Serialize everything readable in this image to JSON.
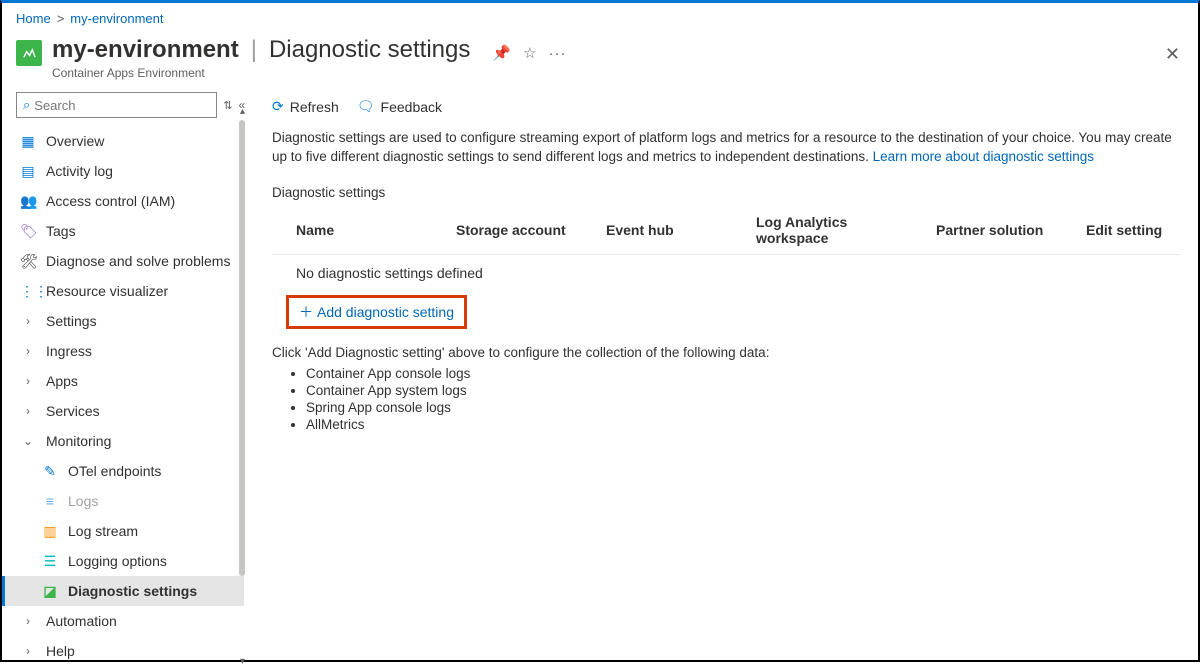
{
  "breadcrumb": {
    "home": "Home",
    "resource": "my-environment"
  },
  "header": {
    "resource_name": "my-environment",
    "page_title": "Diagnostic settings",
    "subtitle": "Container Apps Environment"
  },
  "sidebar": {
    "search_placeholder": "Search",
    "items": {
      "overview": "Overview",
      "activity_log": "Activity log",
      "access_control": "Access control (IAM)",
      "tags": "Tags",
      "diagnose_solve": "Diagnose and solve problems",
      "resource_visualizer": "Resource visualizer",
      "settings": "Settings",
      "ingress": "Ingress",
      "apps": "Apps",
      "services": "Services",
      "monitoring": "Monitoring",
      "otel_endpoints": "OTel endpoints",
      "logs": "Logs",
      "log_stream": "Log stream",
      "logging_options": "Logging options",
      "diagnostic_settings": "Diagnostic settings",
      "automation": "Automation",
      "help": "Help"
    }
  },
  "toolbar": {
    "refresh": "Refresh",
    "feedback": "Feedback"
  },
  "main": {
    "description": "Diagnostic settings are used to configure streaming export of platform logs and metrics for a resource to the destination of your choice. You may create up to five different diagnostic settings to send different logs and metrics to independent destinations. ",
    "learn_more": "Learn more about diagnostic settings",
    "section_label": "Diagnostic settings",
    "columns": {
      "name": "Name",
      "storage": "Storage account",
      "eventhub": "Event hub",
      "law": "Log Analytics workspace",
      "partner": "Partner solution",
      "edit": "Edit setting"
    },
    "empty_row": "No diagnostic settings defined",
    "add_button": "Add diagnostic setting",
    "hint": "Click 'Add Diagnostic setting' above to configure the collection of the following data:",
    "data_types": [
      "Container App console logs",
      "Container App system logs",
      "Spring App console logs",
      "AllMetrics"
    ]
  }
}
